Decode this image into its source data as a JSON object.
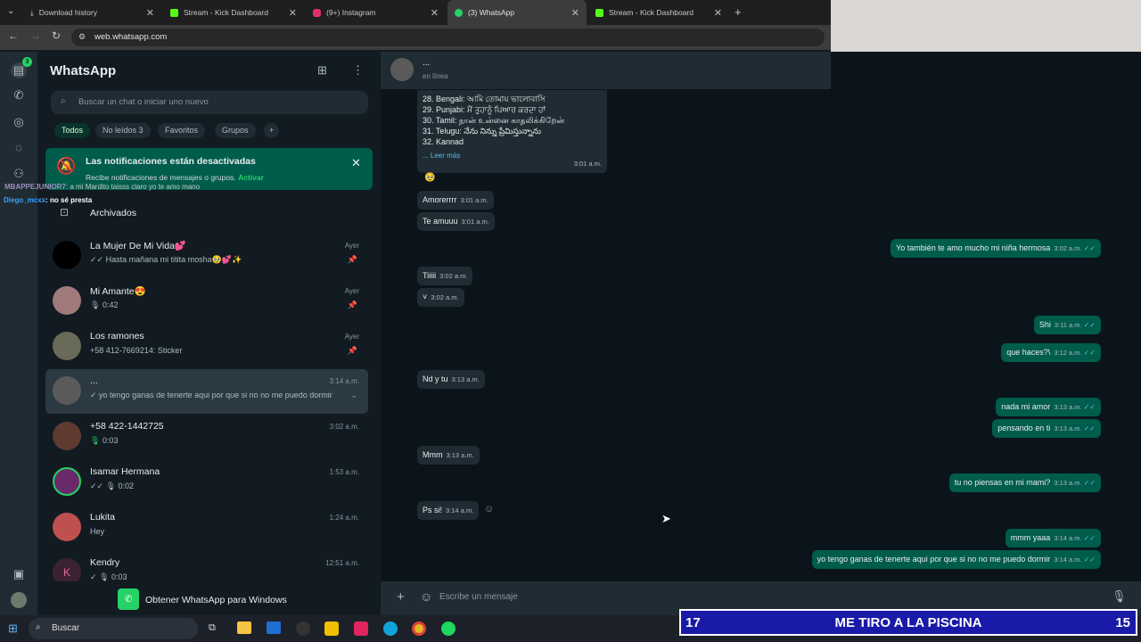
{
  "browser": {
    "tabs": [
      {
        "label": "Download history"
      },
      {
        "label": "Stream - Kick Dashboard"
      },
      {
        "label": "(9+) Instagram"
      },
      {
        "label": "(3) WhatsApp"
      },
      {
        "label": "Stream - Kick Dashboard"
      }
    ],
    "url": "web.whatsapp.com"
  },
  "rail": {
    "badge": "3"
  },
  "app": {
    "title": "WhatsApp"
  },
  "search": {
    "placeholder": "Buscar un chat o iniciar uno nuevo"
  },
  "filters": [
    {
      "label": "Todos"
    },
    {
      "label": "No leídos",
      "count": "3"
    },
    {
      "label": "Favoritos"
    },
    {
      "label": "Grupos"
    }
  ],
  "notice": {
    "title": "Las notificaciones están desactivadas",
    "body": "Recibe notificaciones de mensajes o grupos.",
    "action": "Activar"
  },
  "stream_overlay": {
    "line1_user": "MBAPPEJUNIOR7",
    "line1_text": ": a mi Mardito taisss claro yo te amo mano",
    "line2_user": "Diego_mcxx",
    "line2_text": ": no sé presta"
  },
  "archived": "Archivados",
  "chats": [
    {
      "name": "La Mujer De Mi Vida💕",
      "preview": "Hasta mañana mi titita mosha🥹💕✨",
      "time": "Ayer",
      "pinned": true
    },
    {
      "name": "Mi Amante😍",
      "preview": "0:42",
      "time": "Ayer",
      "pinned": true
    },
    {
      "name": "Los ramones",
      "preview": "+58 412-7669214: Sticker",
      "time": "Ayer",
      "pinned": true
    },
    {
      "name": "...",
      "preview": "yo tengo ganas de tenerte aqui por que si no no me puedo dormir",
      "time": "3:14 a.m.",
      "pinned": false
    },
    {
      "name": "+58 422-1442725",
      "preview": "0:03",
      "time": "3:02 a.m.",
      "pinned": false
    },
    {
      "name": "Isamar Hermana",
      "preview": "0:02",
      "time": "1:53 a.m.",
      "pinned": false
    },
    {
      "name": "Lukita",
      "preview": "Hey",
      "time": "1:24 a.m.",
      "pinned": false
    },
    {
      "name": "Kendry",
      "preview": "0:03",
      "time": "12:51 a.m.",
      "pinned": false,
      "initial": "K"
    }
  ],
  "get_app": "Obtener WhatsApp para Windows",
  "chat": {
    "name": "...",
    "status": "en línea",
    "list_lines": [
      "28. Bengali: আমি তোমায় ভালোবাসি",
      "29. Punjabi: ਮੈਂ ਤੁਹਾਨੂੰ ਪਿਆਰ ਕਰਦਾ ਹਾਂ",
      "30. Tamil: நான் உன்னை காதலிக்கிறேன்",
      "31. Telugu: నేను నిన్ను ప్రేమిస్తున్నాను",
      "32. Kannad"
    ],
    "read_more": "... Leer más",
    "list_time": "3:01 a.m.",
    "messages": [
      {
        "dir": "in",
        "text": "🥹",
        "time": ""
      },
      {
        "dir": "in",
        "text": "Amorerrrr",
        "time": "3:01 a.m."
      },
      {
        "dir": "in",
        "text": "Te amuuu",
        "time": "3:01 a.m."
      },
      {
        "dir": "out",
        "text": "Yo también te amo mucho mi niña hermosa",
        "time": "3:02 a.m."
      },
      {
        "dir": "in",
        "text": "Tiiiii",
        "time": "3:02 a.m."
      },
      {
        "dir": "in",
        "text": "˅",
        "time": "3:02 a.m."
      },
      {
        "dir": "out",
        "text": "Shi",
        "time": "3:11 a.m."
      },
      {
        "dir": "out",
        "text": "que haces?\\",
        "time": "3:12 a.m."
      },
      {
        "dir": "in",
        "text": "Nd y tu",
        "time": "3:13 a.m."
      },
      {
        "dir": "out",
        "text": "nada mi amor",
        "time": "3:13 a.m."
      },
      {
        "dir": "out",
        "text": "pensando en ti",
        "time": "3:13 a.m."
      },
      {
        "dir": "in",
        "text": "Mmm",
        "time": "3:13 a.m."
      },
      {
        "dir": "out",
        "text": "tu no piensas en mi mami?",
        "time": "3:13 a.m."
      },
      {
        "dir": "in",
        "text": "Ps si!",
        "time": "3:14 a.m."
      },
      {
        "dir": "out",
        "text": "mmm yaaa",
        "time": "3:14 a.m."
      },
      {
        "dir": "out",
        "text": "yo tengo ganas de tenerte aqui por que si no no me puedo dormir",
        "time": "3:14 a.m."
      }
    ],
    "composer_placeholder": "Escribe un mensaje"
  },
  "taskbar": {
    "search": "Buscar"
  },
  "banner": {
    "left": "17",
    "title": "ME TIRO A LA PISCINA",
    "right": "15"
  }
}
